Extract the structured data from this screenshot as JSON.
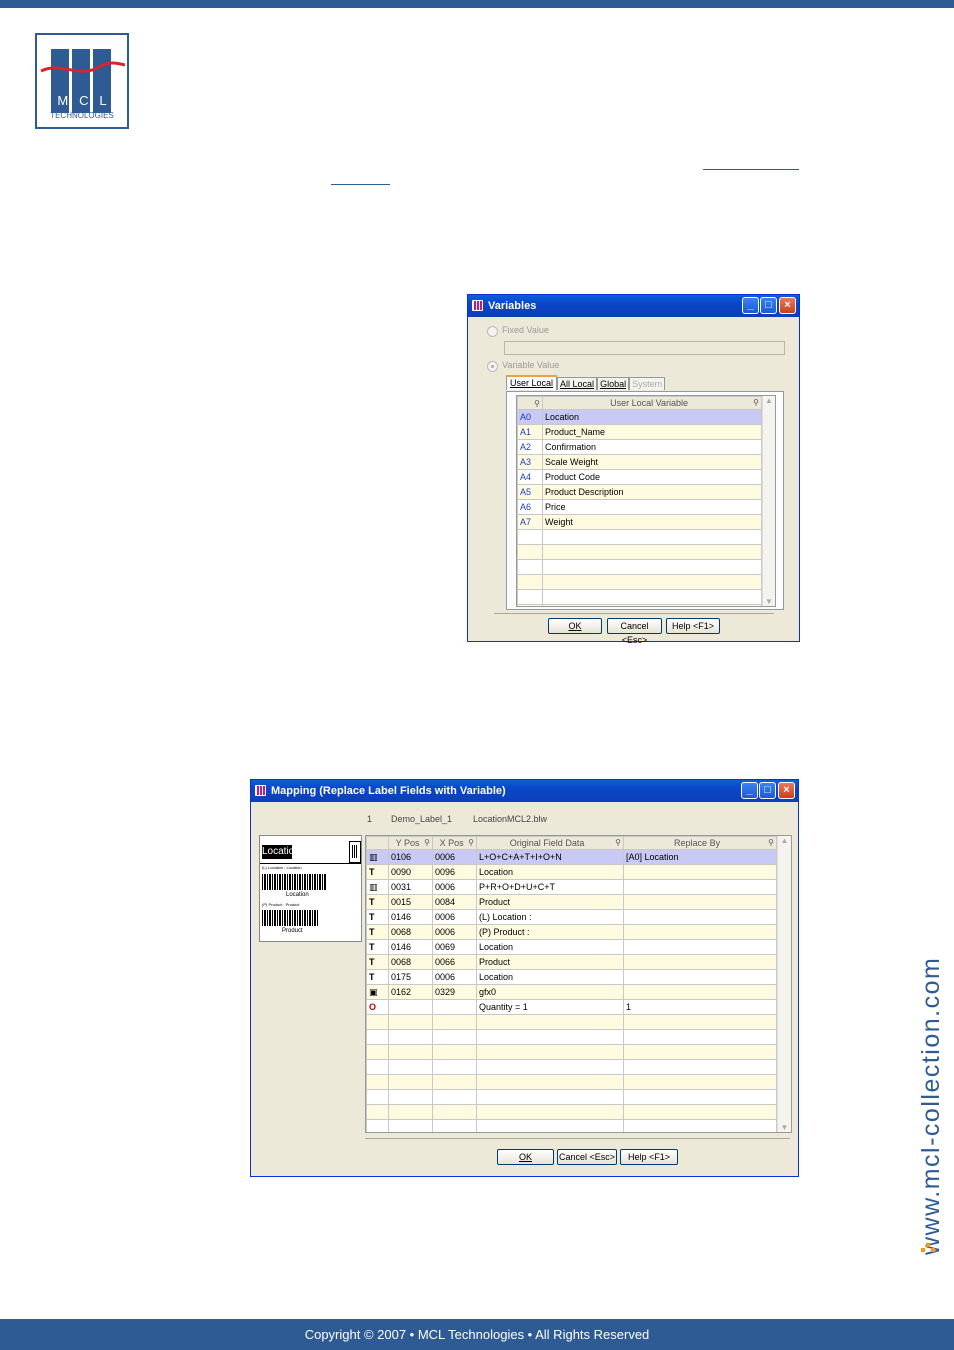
{
  "footer": {
    "copyright": "Copyright © 2007 • MCL Technologies • All Rights Reserved"
  },
  "logo": {
    "letters": [
      "M",
      "C",
      "L"
    ],
    "subtitle": "TECHNOLOGIES"
  },
  "side_url": "www.mcl-collection.com",
  "variables_dialog": {
    "title": "Variables",
    "fixed_value_label": "Fixed Value",
    "variable_value_label": "Variable Value",
    "tabs": [
      {
        "label": "User Local",
        "active": true
      },
      {
        "label": "All Local",
        "active": false
      },
      {
        "label": "Global",
        "active": false
      },
      {
        "label": "System",
        "active": false
      }
    ],
    "column_header": "User Local Variable",
    "rows": [
      {
        "code": "A0",
        "name": "Location",
        "selected": true
      },
      {
        "code": "A1",
        "name": "Product_Name"
      },
      {
        "code": "A2",
        "name": "Confirmation"
      },
      {
        "code": "A3",
        "name": "Scale Weight"
      },
      {
        "code": "A4",
        "name": "Product Code"
      },
      {
        "code": "A5",
        "name": "Product Description"
      },
      {
        "code": "A6",
        "name": "Price"
      },
      {
        "code": "A7",
        "name": "Weight"
      },
      {
        "code": "",
        "name": ""
      },
      {
        "code": "",
        "name": ""
      },
      {
        "code": "",
        "name": ""
      },
      {
        "code": "",
        "name": ""
      },
      {
        "code": "",
        "name": ""
      },
      {
        "code": "",
        "name": ""
      }
    ],
    "buttons": {
      "ok": "OK",
      "cancel": "Cancel <Esc>",
      "help": "Help <F1>"
    }
  },
  "mapping_dialog": {
    "title": "Mapping (Replace Label Fields with Variable)",
    "info": {
      "index": "1",
      "label_name": "Demo_Label_1",
      "file": "LocationMCL2.blw"
    },
    "preview": {
      "title": "Location",
      "line1": "(L) Location : Location",
      "caption1": "Location",
      "line2": "(P) Product : Product",
      "caption2": "Product"
    },
    "columns": [
      "",
      "Y Pos",
      "X Pos",
      "Original Field Data",
      "Replace By"
    ],
    "rows": [
      {
        "icon": "barcode",
        "y": "0106",
        "x": "0006",
        "data": "L+O+C+A+T+I+O+N",
        "replace": "[A0] Location",
        "selected": true
      },
      {
        "icon": "text",
        "y": "0090",
        "x": "0096",
        "data": "Location",
        "replace": ""
      },
      {
        "icon": "barcode",
        "y": "0031",
        "x": "0006",
        "data": "P+R+O+D+U+C+T",
        "replace": ""
      },
      {
        "icon": "text",
        "y": "0015",
        "x": "0084",
        "data": "Product",
        "replace": ""
      },
      {
        "icon": "text",
        "y": "0146",
        "x": "0006",
        "data": "(L) Location :",
        "replace": ""
      },
      {
        "icon": "text",
        "y": "0068",
        "x": "0006",
        "data": "(P) Product :",
        "replace": ""
      },
      {
        "icon": "text",
        "y": "0146",
        "x": "0069",
        "data": "Location",
        "replace": ""
      },
      {
        "icon": "text",
        "y": "0068",
        "x": "0066",
        "data": "Product",
        "replace": ""
      },
      {
        "icon": "text",
        "y": "0175",
        "x": "0006",
        "data": "Location",
        "replace": ""
      },
      {
        "icon": "graphic",
        "y": "0162",
        "x": "0329",
        "data": "gfx0",
        "replace": ""
      },
      {
        "icon": "quantity",
        "y": "",
        "x": "",
        "data": "Quantity =  1",
        "replace": "1"
      },
      {
        "icon": "",
        "y": "",
        "x": "",
        "data": "",
        "replace": ""
      },
      {
        "icon": "",
        "y": "",
        "x": "",
        "data": "",
        "replace": ""
      },
      {
        "icon": "",
        "y": "",
        "x": "",
        "data": "",
        "replace": ""
      },
      {
        "icon": "",
        "y": "",
        "x": "",
        "data": "",
        "replace": ""
      },
      {
        "icon": "",
        "y": "",
        "x": "",
        "data": "",
        "replace": ""
      },
      {
        "icon": "",
        "y": "",
        "x": "",
        "data": "",
        "replace": ""
      },
      {
        "icon": "",
        "y": "",
        "x": "",
        "data": "",
        "replace": ""
      },
      {
        "icon": "",
        "y": "",
        "x": "",
        "data": "",
        "replace": ""
      }
    ],
    "buttons": {
      "ok": "OK",
      "cancel": "Cancel <Esc>",
      "help": "Help <F1>"
    }
  }
}
